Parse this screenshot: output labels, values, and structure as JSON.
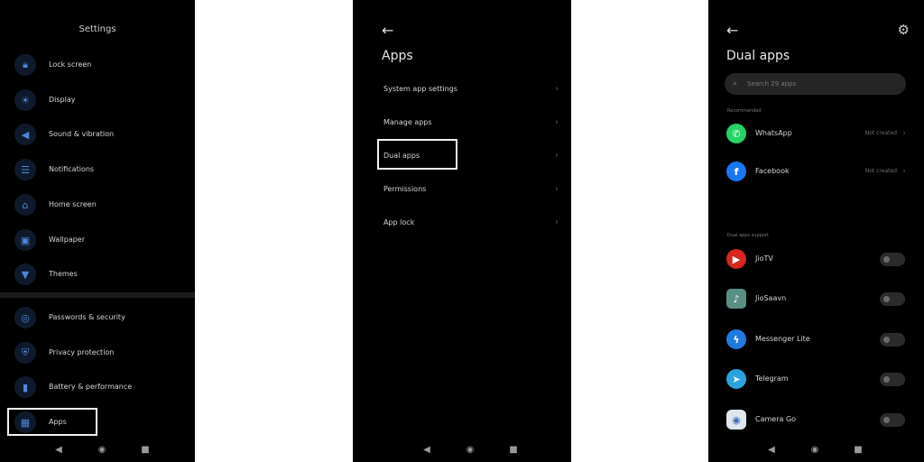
{
  "settings_screen": {
    "title": "Settings",
    "items": [
      {
        "label": "Lock screen",
        "icon": "lock-icon"
      },
      {
        "label": "Display",
        "icon": "display-icon"
      },
      {
        "label": "Sound & vibration",
        "icon": "sound-icon"
      },
      {
        "label": "Notifications",
        "icon": "notifications-icon"
      },
      {
        "label": "Home screen",
        "icon": "home-icon"
      },
      {
        "label": "Wallpaper",
        "icon": "wallpaper-icon"
      },
      {
        "label": "Themes",
        "icon": "themes-icon"
      }
    ],
    "items_lower": [
      {
        "label": "Passwords & security",
        "icon": "fingerprint-icon"
      },
      {
        "label": "Privacy protection",
        "icon": "shield-icon"
      },
      {
        "label": "Battery & performance",
        "icon": "battery-icon"
      },
      {
        "label": "Apps",
        "icon": "apps-icon"
      }
    ]
  },
  "apps_screen": {
    "title": "Apps",
    "items": [
      {
        "label": "System app settings"
      },
      {
        "label": "Manage apps"
      },
      {
        "label": "Dual apps"
      },
      {
        "label": "Permissions"
      },
      {
        "label": "App lock"
      }
    ]
  },
  "dual_apps_screen": {
    "title": "Dual apps",
    "search_placeholder": "Search 29 apps",
    "recommended_label": "Recommended",
    "recommended": [
      {
        "name": "WhatsApp",
        "status": "Not created",
        "icon": "whatsapp-icon"
      },
      {
        "name": "Facebook",
        "status": "Not created",
        "icon": "facebook-icon"
      }
    ],
    "support_label": "Dual apps support",
    "supported": [
      {
        "name": "JioTV",
        "icon": "jiotv-icon",
        "enabled": false
      },
      {
        "name": "JioSaavn",
        "icon": "jiosaavn-icon",
        "enabled": false
      },
      {
        "name": "Messenger Lite",
        "icon": "messenger-lite-icon",
        "enabled": false
      },
      {
        "name": "Telegram",
        "icon": "telegram-icon",
        "enabled": false
      },
      {
        "name": "Camera Go",
        "icon": "camera-go-icon",
        "enabled": false
      }
    ]
  },
  "colors": {
    "background": "#000000",
    "accent_blue": "#4f87d9",
    "highlight_box": "#f2f2f2"
  }
}
